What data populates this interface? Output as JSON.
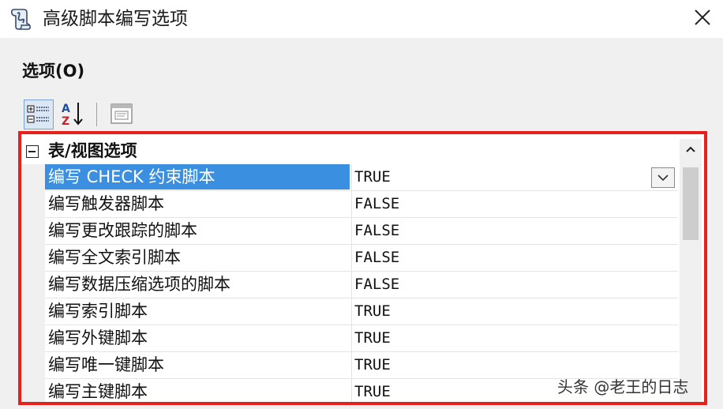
{
  "window": {
    "title": "高级脚本编写选项",
    "close_icon": "close-icon",
    "app_icon": "script-scroll-icon"
  },
  "section": {
    "label": "选项(O)"
  },
  "toolbar": {
    "buttons": [
      {
        "name": "categorized-view-button",
        "icon": "categorized-icon",
        "active": true
      },
      {
        "name": "alphabetical-view-button",
        "icon": "sort-az-icon",
        "active": false
      },
      {
        "name": "property-pages-button",
        "icon": "property-pages-icon",
        "active": false
      }
    ]
  },
  "grid": {
    "category": {
      "label": "表/视图选项",
      "expanded": true
    },
    "rows": [
      {
        "name": "编写 CHECK 约束脚本",
        "value": "TRUE",
        "selected": true
      },
      {
        "name": "编写触发器脚本",
        "value": "FALSE"
      },
      {
        "name": "编写更改跟踪的脚本",
        "value": "FALSE"
      },
      {
        "name": "编写全文索引脚本",
        "value": "FALSE"
      },
      {
        "name": "编写数据压缩选项的脚本",
        "value": "FALSE"
      },
      {
        "name": "编写索引脚本",
        "value": "TRUE"
      },
      {
        "name": "编写外键脚本",
        "value": "TRUE"
      },
      {
        "name": "编写唯一键脚本",
        "value": "TRUE"
      },
      {
        "name": "编写主键脚本",
        "value": "TRUE"
      }
    ],
    "accent_color": "#3b8fe0",
    "highlight_border_color": "#e8201c"
  },
  "watermark": {
    "text": "头条 @老王的日志"
  }
}
